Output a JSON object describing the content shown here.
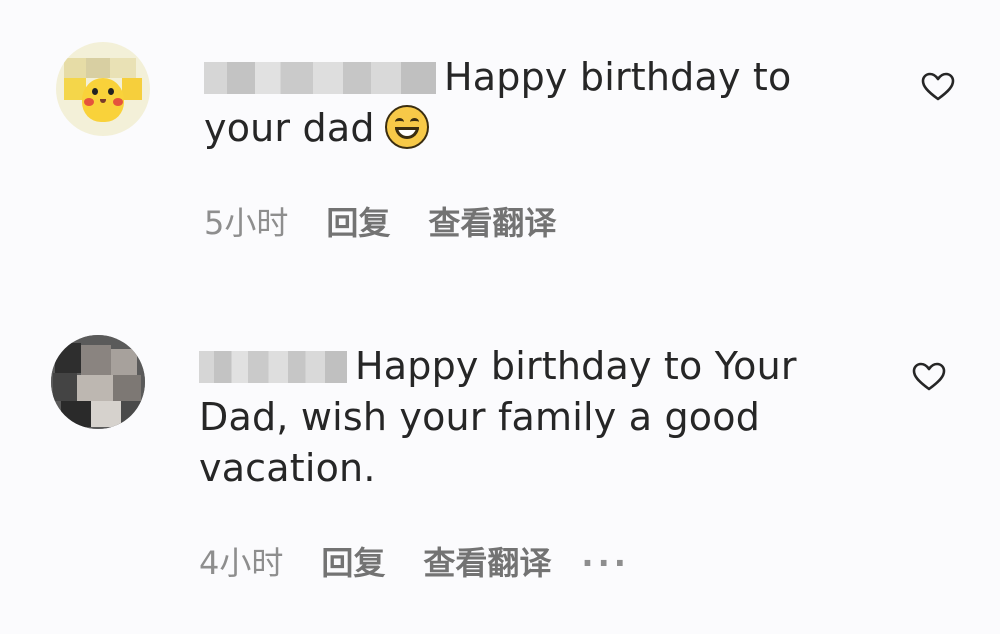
{
  "comments": [
    {
      "text_line1": "Happy birthday to",
      "text_line2": "your dad",
      "emoji_icon": "grinning-face-icon",
      "time": "5小时",
      "reply_label": "回复",
      "translate_label": "查看翻译"
    },
    {
      "text_line1": "Happy birthday to Your",
      "text_line2": "Dad, wish your family a good",
      "text_line3": "vacation.",
      "time": "4小时",
      "reply_label": "回复",
      "translate_label": "查看翻译",
      "more_label": "···"
    }
  ],
  "colors": {
    "text": "#262626",
    "meta": "#8e8e8e",
    "background": "#fbfbfd"
  }
}
